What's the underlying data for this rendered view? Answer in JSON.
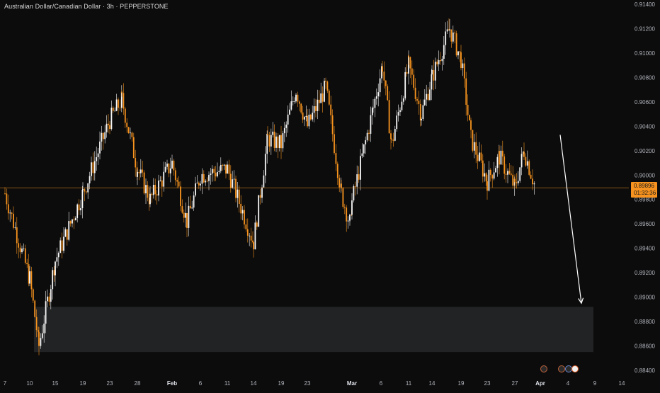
{
  "header": {
    "title": "Australian Dollar/Canadian Dollar · 3h · PEPPERSTONE"
  },
  "price_tag": {
    "price": "0.89896",
    "countdown": "01:32:36"
  },
  "colors": {
    "background": "#0c0c0c",
    "bull_candle": "#f7f7f7",
    "bear_candle": "#f7931e",
    "price_line": "#f7931e",
    "zone": "#222324",
    "arrow": "#ffffff",
    "axis_text": "#b2b5be"
  },
  "event_markers": [
    "dividend-icon",
    "dividend-icon",
    "earnings-icon"
  ],
  "chart_data": {
    "type": "candlestick",
    "title": "Australian Dollar/Canadian Dollar · 3h · PEPPERSTONE",
    "yrange": [
      0.884,
      0.914
    ],
    "yticks": [
      "0.91400",
      "0.91200",
      "0.91000",
      "0.90800",
      "0.90600",
      "0.90400",
      "0.90200",
      "0.90000",
      "0.89800",
      "0.89600",
      "0.89400",
      "0.89200",
      "0.89000",
      "0.88800",
      "0.88600",
      "0.88400"
    ],
    "xticks": [
      "7",
      "10",
      "15",
      "19",
      "23",
      "28",
      "Feb",
      "6",
      "11",
      "14",
      "19",
      "23",
      "Mar",
      "6",
      "11",
      "14",
      "19",
      "23",
      "27",
      "Apr",
      "4",
      "9",
      "14"
    ],
    "last_price": 0.89896,
    "current_price_label": "0.89896",
    "countdown": "01:32:36",
    "demand_zone": {
      "from": 0.8855,
      "to": 0.8892,
      "start": "10",
      "end": "9"
    },
    "projection_arrow": {
      "from": 0.9033,
      "to": 0.8895,
      "direction": "down"
    },
    "price_path": [
      {
        "date": "7",
        "close": 0.8985
      },
      {
        "date": "10",
        "close": 0.8915
      },
      {
        "date": "11",
        "close": 0.886
      },
      {
        "date": "15",
        "close": 0.893
      },
      {
        "date": "19",
        "close": 0.8985
      },
      {
        "date": "23",
        "close": 0.9045
      },
      {
        "date": "25",
        "close": 0.9062
      },
      {
        "date": "28",
        "close": 0.9005
      },
      {
        "date": "31",
        "close": 0.898
      },
      {
        "date": "Feb",
        "close": 0.901
      },
      {
        "date": "3",
        "close": 0.8962
      },
      {
        "date": "6",
        "close": 0.9
      },
      {
        "date": "11",
        "close": 0.9005
      },
      {
        "date": "14",
        "close": 0.8945
      },
      {
        "date": "17",
        "close": 0.903
      },
      {
        "date": "19",
        "close": 0.9025
      },
      {
        "date": "21",
        "close": 0.907
      },
      {
        "date": "23",
        "close": 0.904
      },
      {
        "date": "25",
        "close": 0.9072
      },
      {
        "date": "27",
        "close": 0.8985
      },
      {
        "date": "28",
        "close": 0.896
      },
      {
        "date": "Mar",
        "close": 0.8978
      },
      {
        "date": "4",
        "close": 0.9055
      },
      {
        "date": "6",
        "close": 0.909
      },
      {
        "date": "8",
        "close": 0.9025
      },
      {
        "date": "11",
        "close": 0.909
      },
      {
        "date": "13",
        "close": 0.905
      },
      {
        "date": "14",
        "close": 0.908
      },
      {
        "date": "17",
        "close": 0.912
      },
      {
        "date": "19",
        "close": 0.9095
      },
      {
        "date": "20",
        "close": 0.903
      },
      {
        "date": "23",
        "close": 0.8995
      },
      {
        "date": "25",
        "close": 0.9015
      },
      {
        "date": "27",
        "close": 0.899
      },
      {
        "date": "28",
        "close": 0.902
      },
      {
        "date": "30",
        "close": 0.899
      }
    ]
  }
}
